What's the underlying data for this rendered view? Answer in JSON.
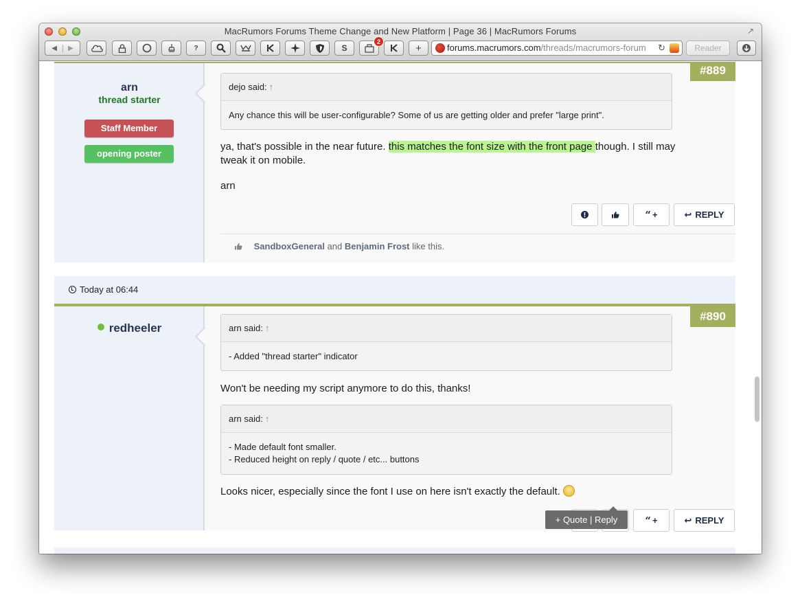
{
  "window": {
    "title": "MacRumors Forums Theme Change and New Platform | Page 36 | MacRumors Forums",
    "url_host": "forums.macrumors.com",
    "url_path": "/threads/macrumors-forum",
    "reader_label": "Reader",
    "extension_badge": "2",
    "toolbar_icons": [
      "back-icon",
      "forward-icon",
      "cloud-icon",
      "lock-icon",
      "circle-icon",
      "stamp-icon",
      "question-icon",
      "search-icon",
      "crown-icon",
      "first-icon",
      "puzzle-icon",
      "shield-icon",
      "dollar-icon",
      "extension-icon",
      "k-icon",
      "add-tab-icon"
    ]
  },
  "posts": [
    {
      "username": "arn",
      "user_title": "thread starter",
      "banners": [
        "Staff Member",
        "opening poster"
      ],
      "post_number": "#889",
      "quote": {
        "author": "dejo said:",
        "text": "Any chance this will be user-configurable? Some of us are getting older and prefer \"large print\"."
      },
      "message_before": "ya, that's possible in the near future. ",
      "message_highlight": "this matches the font size with the front page ",
      "message_after": "though. I still may tweak it on mobile.",
      "signature": "arn",
      "buttons": {
        "report": "!",
        "like": "like",
        "quote": "+",
        "reply": "REPLY"
      },
      "likes": {
        "user1": "SandboxGeneral",
        "and": "and",
        "user2": "Benjamin Frost",
        "suffix": "like this."
      }
    },
    {
      "date": "Today at 06:44",
      "username": "redheeler",
      "post_number": "#890",
      "quote1": {
        "author": "arn said:",
        "text": "- Added \"thread starter\" indicator"
      },
      "message1": "Won't be needing my script anymore to do this, thanks!",
      "quote2": {
        "author": "arn said:",
        "line1": "- Made default font smaller.",
        "line2": "- Reduced height on reply / quote / etc... buttons"
      },
      "message2": "Looks nicer, especially since the font I use on here isn't exactly the default.",
      "tooltip": {
        "quote": "+ Quote",
        "sep": "|",
        "reply": "Reply"
      },
      "buttons": {
        "report": "!",
        "like": "like",
        "quote": "+",
        "reply": "REPLY"
      }
    }
  ],
  "colors": {
    "post_number_bg": "#a3ae5e",
    "staff_banner": "#c75256",
    "op_banner": "#55c160",
    "highlight": "#b8f58e",
    "user_column": "#ecf2f8"
  }
}
